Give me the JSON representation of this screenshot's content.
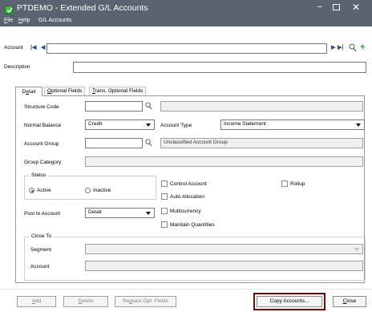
{
  "window": {
    "title": "PTDEMO - Extended G/L Accounts",
    "controls": {
      "minimize": "−",
      "close": "✕"
    }
  },
  "menu": {
    "file_first": "F",
    "file_rest": "ile",
    "help_first": "H",
    "help_rest": "elp",
    "gl_accounts": "G/L Accounts"
  },
  "header": {
    "account_label": "Account",
    "account_value": "",
    "description_label": "Description",
    "description_value": ""
  },
  "tabs": {
    "detail_a": "D",
    "detail_u": "e",
    "detail_b": "tail",
    "optional_u": "O",
    "optional_rest": "ptional Fields",
    "trans_u": "T",
    "trans_rest": "rans. Optional Fields"
  },
  "detail": {
    "structure_code_label": "Structure Code",
    "structure_code_value": "",
    "structure_desc": "",
    "normal_balance_label": "Normal Balance",
    "normal_balance_value": "Credit",
    "account_type_label": "Account Type",
    "account_type_value": "Income Statement",
    "account_group_label": "Account Group",
    "account_group_value": "",
    "account_group_desc": "Unclassified Account Group",
    "group_category_label": "Group Category",
    "group_category_value": "",
    "status_label": "Status",
    "status_active": "Active",
    "status_inactive": "Inactive",
    "status_selected": "Active",
    "control_account": "Control Account",
    "rollup": "Rollup",
    "auto_allocation": "Auto Allocation",
    "post_to_label": "Post to Account",
    "post_to_value": "Detail",
    "multicurrency": "Multicurrency",
    "maintain_quantities": "Maintain Quantities",
    "close_to_label": "Close To",
    "segment_label": "Segment",
    "segment_value": "",
    "close_account_label": "Account",
    "close_account_value": ""
  },
  "buttons": {
    "add_u": "A",
    "add_rest": "dd",
    "delete_u": "D",
    "delete_rest": "elete",
    "replace_a": "Re",
    "replace_u": "p",
    "replace_b": "lace Opt. Fields",
    "copy_accounts": "Copy Accounts...",
    "close_u": "C",
    "close_rest": "lose"
  },
  "colors": {
    "titlebar": "#5a6470",
    "highlight": "#7a0a0a",
    "nav_arrows": "#2b4f9e",
    "add_green": "#30a030"
  },
  "icons": {
    "first": "first-record-icon",
    "prev": "previous-record-icon",
    "next": "next-record-icon",
    "last": "last-record-icon",
    "finder": "finder-magnifier-icon",
    "new": "add-new-icon"
  }
}
